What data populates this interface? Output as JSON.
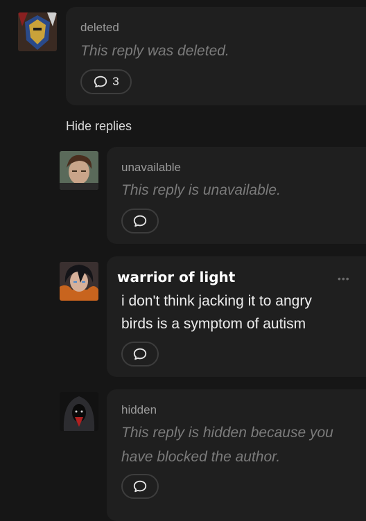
{
  "thread": {
    "top_reply": {
      "author": "deleted",
      "text": "This reply was deleted.",
      "reply_count": "3",
      "avatar_icon": "armored-knight-avatar"
    },
    "hide_replies_label": "Hide replies",
    "replies": [
      {
        "author": "unavailable",
        "text": "This reply is unavailable.",
        "avatar_icon": "brown-haired-man-avatar"
      },
      {
        "author": "warrior of light",
        "lines": [
          "i don't think jacking it to angry",
          "birds is a symptom of autism"
        ],
        "more_label": "•••",
        "avatar_icon": "dark-haired-warrior-avatar"
      },
      {
        "author": "hidden",
        "lines": [
          "This reply is hidden because you",
          "have blocked the author."
        ],
        "avatar_icon": "hooded-figure-avatar"
      }
    ]
  },
  "colors": {
    "background": "#161616",
    "card": "#1f1f1f",
    "muted_text": "#7b7b7b",
    "primary_text": "#ededed"
  }
}
